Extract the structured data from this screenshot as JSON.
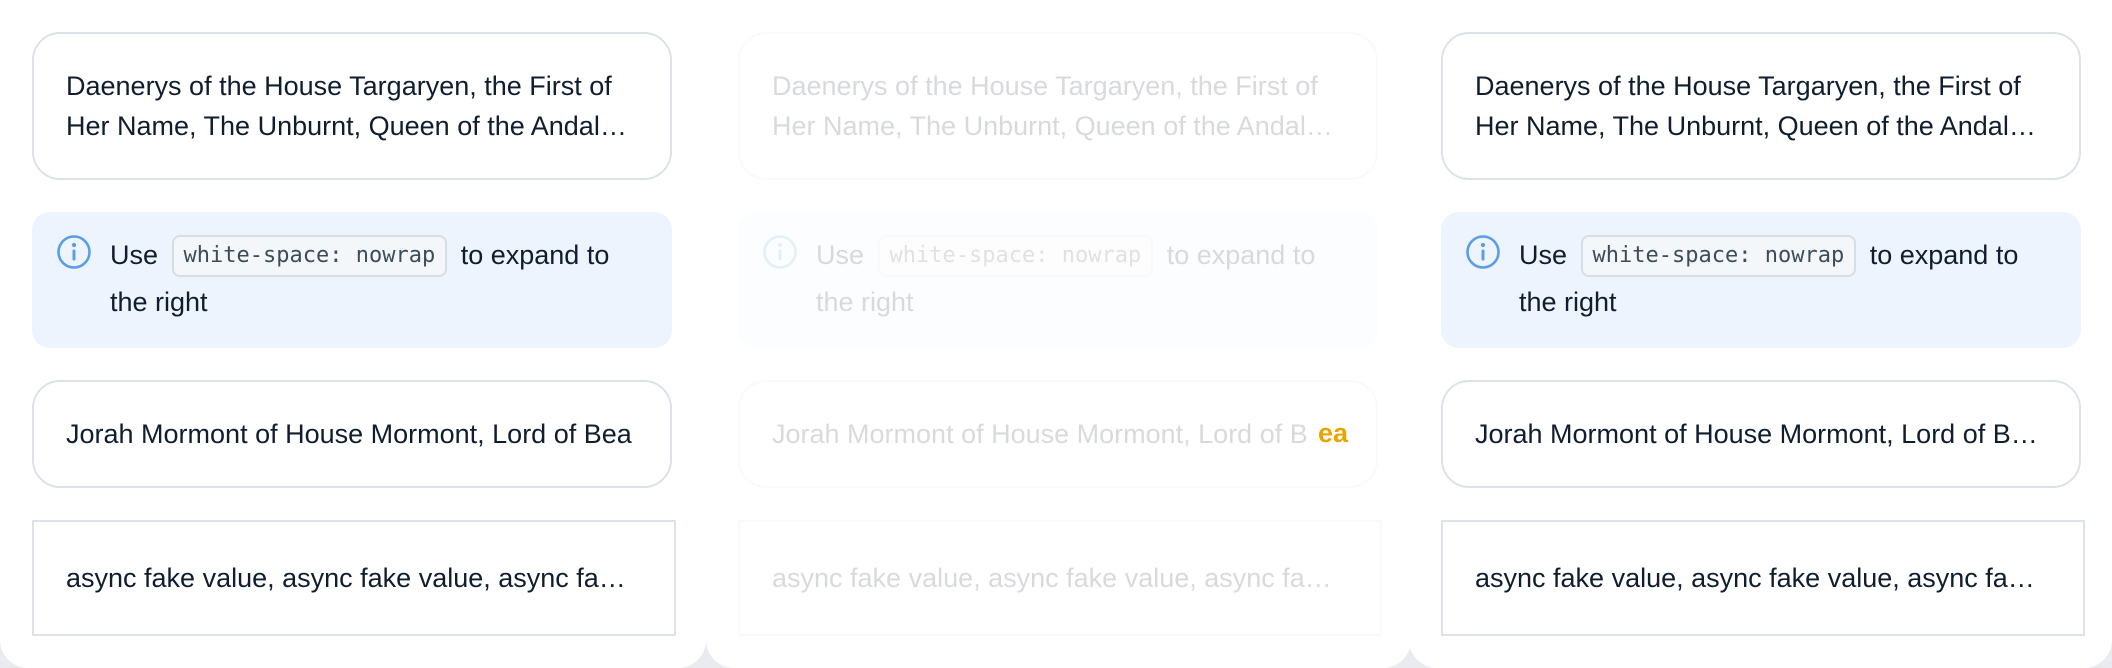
{
  "panels": [
    {
      "multiline_text": "Daenerys of the House Targaryen, the First of Her Name, The Unburnt, Queen of the Andal…",
      "info": {
        "prefix": "Use",
        "code": "white-space: nowrap",
        "suffix": "to expand to the right"
      },
      "single_line_text": "Jorah Mormont of House Mormont, Lord of Bea",
      "async_text": "async fake value, async fake value, async fak…"
    },
    {
      "multiline_text": "Daenerys of the House Targaryen, the First of Her Name, The Unburnt, Queen of the Andal…",
      "info": {
        "prefix": "Use",
        "code": "white-space: nowrap",
        "suffix": "to expand to the right"
      },
      "single_line_text": "Jorah Mormont of House Mormont, Lord of B",
      "overflow_glyph": "ea",
      "async_text": "async fake value, async fake value, async fak…"
    },
    {
      "multiline_text": "Daenerys of the House Targaryen, the First of Her Name, The Unburnt, Queen of the Andal…",
      "info": {
        "prefix": "Use",
        "code": "white-space: nowrap",
        "suffix": "to expand to the right"
      },
      "single_line_text": "Jorah Mormont of House Mormont, Lord of B…",
      "async_text": "async fake value, async fake value, async fak…"
    }
  ],
  "colors": {
    "info_background": "#edf4fd",
    "info_icon": "#5a9ee8",
    "overflow_highlight": "#e8a400"
  },
  "icons": {
    "info": "info-circle-icon"
  }
}
